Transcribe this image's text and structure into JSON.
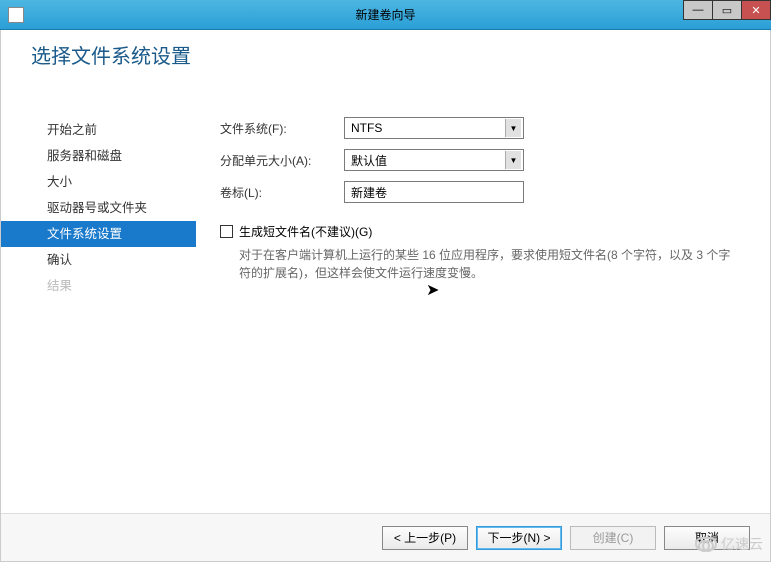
{
  "window": {
    "title": "新建卷向导"
  },
  "page": {
    "heading": "选择文件系统设置"
  },
  "sidebar": {
    "items": [
      {
        "label": "开始之前",
        "state": "normal"
      },
      {
        "label": "服务器和磁盘",
        "state": "normal"
      },
      {
        "label": "大小",
        "state": "normal"
      },
      {
        "label": "驱动器号或文件夹",
        "state": "normal"
      },
      {
        "label": "文件系统设置",
        "state": "active"
      },
      {
        "label": "确认",
        "state": "normal"
      },
      {
        "label": "结果",
        "state": "disabled"
      }
    ]
  },
  "form": {
    "filesystem_label": "文件系统(F):",
    "filesystem_value": "NTFS",
    "alloc_label": "分配单元大小(A):",
    "alloc_value": "默认值",
    "volume_label_label": "卷标(L):",
    "volume_label_value": "新建卷",
    "shortnames_checkbox_label": "生成短文件名(不建议)(G)",
    "shortnames_help": "对于在客户端计算机上运行的某些 16 位应用程序，要求使用短文件名(8 个字符，以及 3 个字符的扩展名)，但这样会使文件运行速度变慢。"
  },
  "footer": {
    "previous": "< 上一步(P)",
    "next": "下一步(N) >",
    "create": "创建(C)",
    "cancel": "取消"
  },
  "watermark": "亿速云"
}
